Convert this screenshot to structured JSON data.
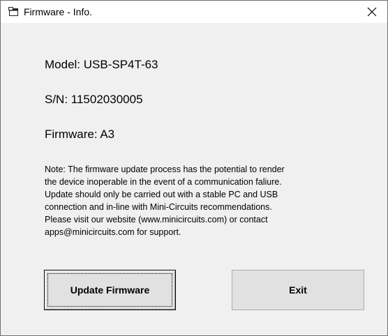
{
  "window": {
    "title": "Firmware - Info.",
    "icon": "window-app-icon",
    "close_icon": "close-icon"
  },
  "info": {
    "model": "Model: USB-SP4T-63",
    "serial": "S/N: 11502030005",
    "firmware": "Firmware: A3"
  },
  "note": {
    "lines": [
      "Note: The firmware update process has the potential to render",
      "the device inoperable in the event of a communication faliure.",
      "Update should only be carried out with a stable PC and USB",
      "connection and in-line with Mini-Circuits recommendations.",
      "Please visit our website (www.minicircuits.com) or contact",
      "apps@minicircuits.com for support."
    ]
  },
  "buttons": {
    "update_label": "Update Firmware",
    "exit_label": "Exit"
  }
}
